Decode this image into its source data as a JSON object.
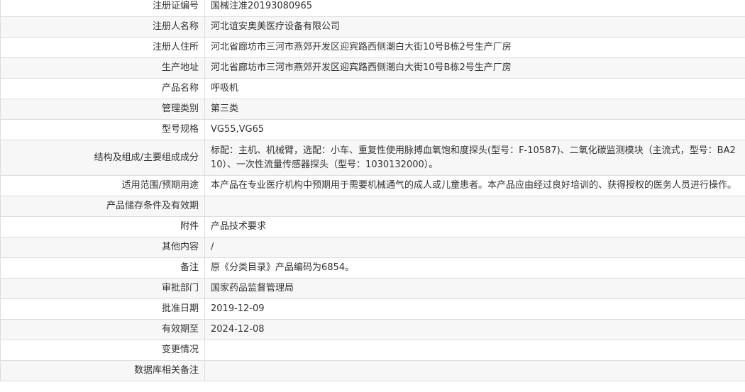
{
  "rows": [
    {
      "label": "注册证编号",
      "value": "国械注准20193080965"
    },
    {
      "label": "注册人名称",
      "value": "河北谊安奥美医疗设备有限公司"
    },
    {
      "label": "注册人住所",
      "value": "河北省廊坊市三河市燕郊开发区迎宾路西侧潮白大街10号B栋2号生产厂房"
    },
    {
      "label": "生产地址",
      "value": "河北省廊坊市三河市燕郊开发区迎宾路西侧潮白大街10号B栋2号生产厂房"
    },
    {
      "label": "产品名称",
      "value": "呼吸机"
    },
    {
      "label": "管理类别",
      "value": "第三类"
    },
    {
      "label": "型号规格",
      "value": "VG55,VG65"
    },
    {
      "label": "结构及组成/主要组成成分",
      "value": "标配：主机、机械臂，选配：小车、重复性使用脉搏血氧饱和度探头(型号：F-10587)、二氧化碳监测模块（主流式，型号：BA210）、一次性流量传感器探头（型号：1030132000）。"
    },
    {
      "label": "适用范围/预期用途",
      "value": "本产品在专业医疗机构中预期用于需要机械通气的成人或儿童患者。本产品应由经过良好培训的、获得授权的医务人员进行操作。"
    },
    {
      "label": "产品储存条件及有效期",
      "value": ""
    },
    {
      "label": "附件",
      "value": "产品技术要求"
    },
    {
      "label": "其他内容",
      "value": "/"
    },
    {
      "label": "备注",
      "value": "原《分类目录》产品编码为6854。"
    },
    {
      "label": "审批部门",
      "value": "国家药品监督管理局"
    },
    {
      "label": "批准日期",
      "value": "2019-12-09"
    },
    {
      "label": "有效期至",
      "value": "2024-12-08"
    },
    {
      "label": "变更情况",
      "value": ""
    },
    {
      "label": "数据库相关备注",
      "value": ""
    }
  ]
}
